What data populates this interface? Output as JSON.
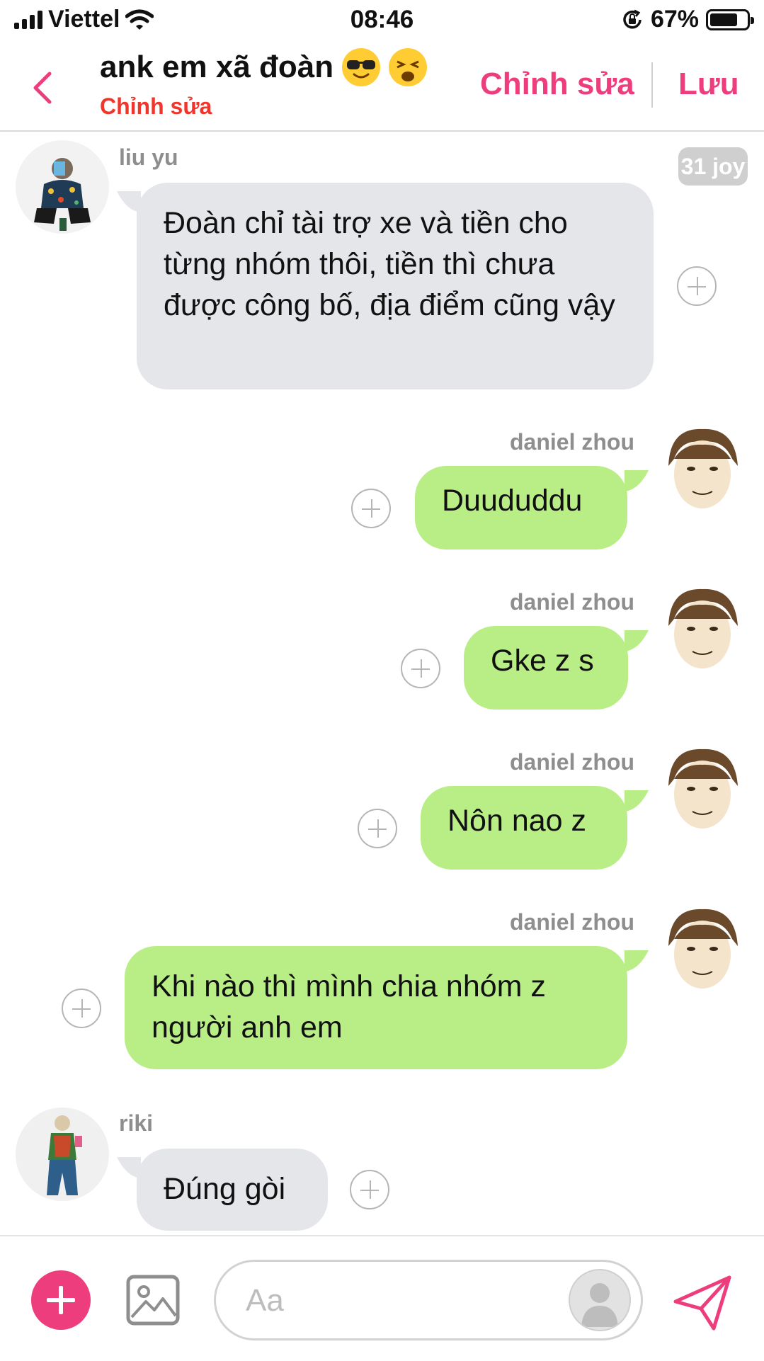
{
  "status_bar": {
    "carrier": "Viettel",
    "time": "08:46",
    "battery": "67%"
  },
  "header": {
    "title": "ank em xã đoàn",
    "title_emojis": [
      "smiling-face-with-sunglasses",
      "weary-face"
    ],
    "subtitle": "Chỉnh sửa",
    "edit_label": "Chỉnh sửa",
    "save_label": "Lưu"
  },
  "date_badge": "31 joy",
  "messages": [
    {
      "sender": "liu yu",
      "direction": "incoming",
      "text": "Đoàn chỉ tài trợ xe và tiền cho từng nhóm thôi, tiền thì chưa được công bố, địa điểm cũng vậy"
    },
    {
      "sender": "daniel zhou",
      "direction": "outgoing",
      "text": "Duududdu"
    },
    {
      "sender": "daniel zhou",
      "direction": "outgoing",
      "text": "Gke z s"
    },
    {
      "sender": "daniel zhou",
      "direction": "outgoing",
      "text": "Nôn nao z"
    },
    {
      "sender": "daniel zhou",
      "direction": "outgoing",
      "text": "Khi nào thì mình chia nhóm z người anh em"
    },
    {
      "sender": "riki",
      "direction": "incoming",
      "text": "Đúng gòi"
    }
  ],
  "composer": {
    "placeholder": "Aa"
  },
  "colors": {
    "accent": "#ee3d7c",
    "outgoing_bubble": "#b9ee87",
    "incoming_bubble": "#e5e6ea",
    "subtitle": "#f2352a"
  }
}
